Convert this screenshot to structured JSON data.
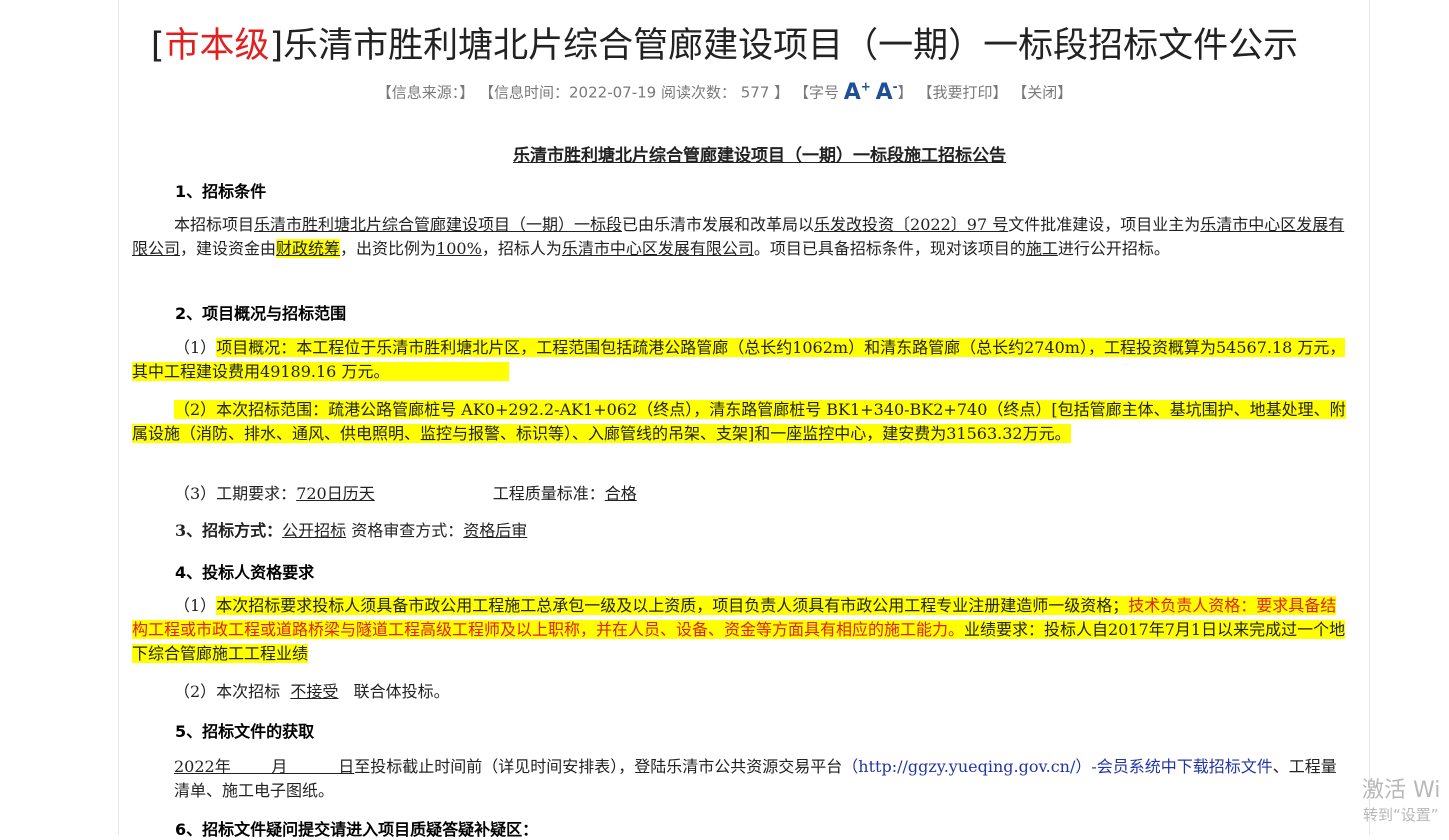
{
  "header": {
    "title_level": "市本级",
    "title_text": "乐清市胜利塘北片综合管廊建设项目（一期）一标段招标文件公示",
    "meta": {
      "source": "【信息来源：】",
      "time": "【信息时间：2022-07-19 阅读次数：",
      "count": "577",
      "time_close": "】",
      "font_label": "【字号",
      "font_up": "A",
      "font_down": "A",
      "font_close": "】",
      "print": "【我要打印】",
      "close": "【关闭】"
    }
  },
  "doc": {
    "heading": "乐清市胜利塘北片综合管廊建设项目（一期）一标段施工招标公告",
    "s1_title": "1、招标条件",
    "s1": {
      "a": "本招标项目",
      "project": "乐清市胜利塘北片综合管廊建设项目（一期）一标段",
      "b": "已由乐清市发展和改革局以",
      "doc": "乐发改投资〔2022〕97 号",
      "c": "文件批准建设，项目业主为",
      "owner": "乐清市中心区发展有限公司",
      "d": "，建设资金由",
      "fund": "财政统筹",
      "e": "，出资比例为",
      "ratio": "100%",
      "f": "，招标人为",
      "tenderer": "乐清市中心区发展有限公司",
      "g": "。项目已具备招标条件，现对该项目的",
      "scope": "施工",
      "h": "进行公开招标。"
    },
    "s2_title": "2、项目概况与招标范围",
    "s2_1": {
      "prefix": "（1）",
      "text": "项目概况：本工程位于乐清市胜利塘北片区，工程范围包括疏港公路管廊（总长约1062m）和清东路管廊（总长约2740m），工程投资概算为",
      "total": "54567.18",
      "mid": " 万元，其中工程建设费用",
      "build": "49189.16",
      "end": "  万元。"
    },
    "s2_2": {
      "text": "（2）本次招标范围：疏港公路管廊桩号 AK0+292.2-AK1+062（终点），清东路管廊桩号 BK1+340-BK2+740（终点）[包括管廊主体、基坑围护、地基处理、附属设施（消防、排水、通风、供电照明、监控与报警、标识等）、入廊管线的吊架、支架]和一座监控中心，建安费为31563.32万元。"
    },
    "s2_3": {
      "label": "（3）工期要求：",
      "period": "720日历天",
      "q_label": "工程质量标准：",
      "quality": "合格"
    },
    "s3": {
      "title": "3、招标方式：",
      "method": "公开招标",
      "review_label": "资格审查方式：",
      "review": "资格后审"
    },
    "s4_title": "4、投标人资格要求",
    "s4_1": {
      "prefix": "（1）",
      "a": "本次招标要求投标人须具备市政公用工程施工总承包一级及以上资质，项目负责人须具有市政公用工程专业注册建造师一级资格；",
      "b": "技术负责人资格：要求具备结构工程或市政工程或道路桥梁与隧道工程高级工程师及以上职称，并在人员、设备、资金等方面具有相应的施工能力。",
      "c": "业绩要求：投标人自2017年7月1日以来完成过一个地下综合管廊施工工程业绩"
    },
    "s4_2": {
      "a": "（2）本次招标",
      "accept": "不接受",
      "b": "联合体投标。"
    },
    "s5_title": "5、招标文件的获取",
    "s5": {
      "date": "2022年        月          日",
      "a": "至投标截止时间前（详见时间安排表），登陆乐清市公共资源交易平台",
      "link": "（http://ggzy.yueqing.gov.cn/）-会员系统中下载招标文件",
      "b": "、工程量清单、施工电子图纸。"
    },
    "s6_title": "6、招标文件疑问提交请进入项目质疑答疑补疑区："
  },
  "watermark": {
    "line1": "激活 Wi",
    "line2": "转到“设置”"
  }
}
